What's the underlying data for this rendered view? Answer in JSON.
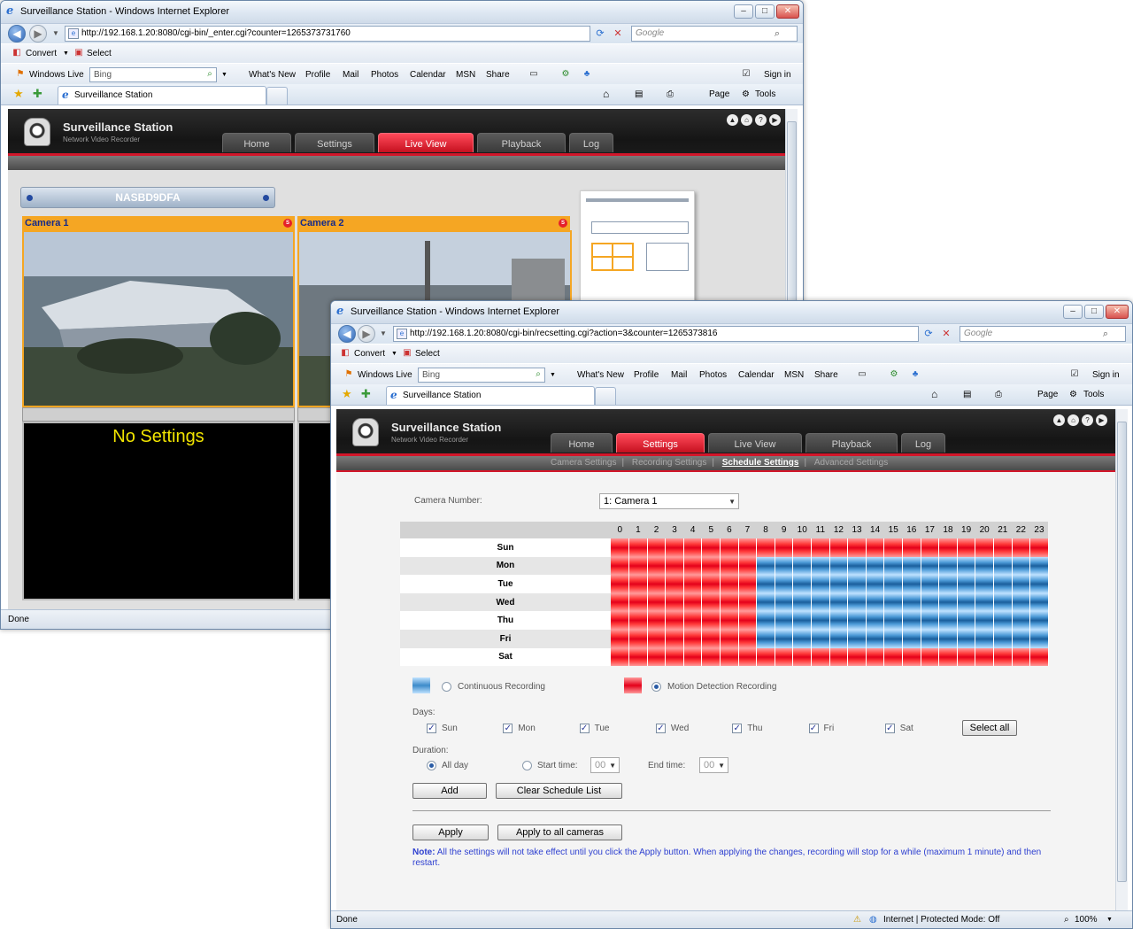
{
  "back_window": {
    "title": "Surveillance Station - Windows Internet Explorer",
    "url": "http://192.168.1.20:8080/cgi-bin/_enter.cgi?counter=1265373731760",
    "search_placeholder": "Google",
    "toolbar": {
      "convert": "Convert",
      "select": "Select"
    },
    "links": {
      "windows_live": "Windows Live",
      "bing": "Bing",
      "whats_new": "What's New",
      "profile": "Profile",
      "mail": "Mail",
      "photos": "Photos",
      "calendar": "Calendar",
      "msn": "MSN",
      "share": "Share",
      "sign_in": "Sign in"
    },
    "tab_label": "Surveillance Station",
    "commands": {
      "page": "Page",
      "tools": "Tools"
    },
    "app": {
      "title": "Surveillance Station",
      "subtitle": "Network Video Recorder"
    },
    "nav_tabs": [
      "Home",
      "Settings",
      "Live View",
      "Playback",
      "Log"
    ],
    "active_tab": "Live View",
    "server_name": "NASBD9DFA",
    "cameras": [
      {
        "label": "Camera 1"
      },
      {
        "label": "Camera 2"
      }
    ],
    "no_settings": "No Settings",
    "status": "Done"
  },
  "front_window": {
    "title": "Surveillance Station - Windows Internet Explorer",
    "url": "http://192.168.1.20:8080/cgi-bin/recsetting.cgi?action=3&counter=1265373816",
    "search_placeholder": "Google",
    "toolbar": {
      "convert": "Convert",
      "select": "Select"
    },
    "links": {
      "windows_live": "Windows Live",
      "bing": "Bing",
      "whats_new": "What's New",
      "profile": "Profile",
      "mail": "Mail",
      "photos": "Photos",
      "calendar": "Calendar",
      "msn": "MSN",
      "share": "Share",
      "sign_in": "Sign in"
    },
    "tab_label": "Surveillance Station",
    "commands": {
      "page": "Page",
      "tools": "Tools"
    },
    "app": {
      "title": "Surveillance Station",
      "subtitle": "Network Video Recorder"
    },
    "nav_tabs": [
      "Home",
      "Settings",
      "Live View",
      "Playback",
      "Log"
    ],
    "active_tab": "Settings",
    "sub_nav": [
      "Camera Settings",
      "Recording Settings",
      "Schedule Settings",
      "Advanced Settings"
    ],
    "active_sub": "Schedule Settings",
    "camera_number_label": "Camera Number:",
    "camera_number_value": "1: Camera 1",
    "hours": [
      "0",
      "1",
      "2",
      "3",
      "4",
      "5",
      "6",
      "7",
      "8",
      "9",
      "10",
      "11",
      "12",
      "13",
      "14",
      "15",
      "16",
      "17",
      "18",
      "19",
      "20",
      "21",
      "22",
      "23"
    ],
    "schedule": [
      {
        "day": "Sun",
        "motion_until_hour": 24
      },
      {
        "day": "Mon",
        "motion_until_hour": 8
      },
      {
        "day": "Tue",
        "motion_until_hour": 8
      },
      {
        "day": "Wed",
        "motion_until_hour": 8
      },
      {
        "day": "Thu",
        "motion_until_hour": 8
      },
      {
        "day": "Fri",
        "motion_until_hour": 8
      },
      {
        "day": "Sat",
        "motion_until_hour": 24
      }
    ],
    "legend": {
      "continuous": "Continuous Recording",
      "motion": "Motion Detection Recording"
    },
    "colors": {
      "continuous": "#1a5e9c",
      "motion": "#e4001a",
      "accent": "#d2162a"
    },
    "days_label": "Days:",
    "days": [
      "Sun",
      "Mon",
      "Tue",
      "Wed",
      "Thu",
      "Fri",
      "Sat"
    ],
    "select_all": "Select all",
    "duration_label": "Duration:",
    "all_day": "All day",
    "start_time_label": "Start time:",
    "start_time_value": "00",
    "end_time_label": "End time:",
    "end_time_value": "00",
    "add": "Add",
    "clear_schedule": "Clear Schedule List",
    "apply": "Apply",
    "apply_all": "Apply to all cameras",
    "note_label": "Note:",
    "note_text": "All the settings will not take effect until you click the Apply button. When applying the changes, recording will stop for a while (maximum 1 minute) and then restart.",
    "status": "Done",
    "zone": "Internet | Protected Mode: Off",
    "zoom": "100%"
  }
}
